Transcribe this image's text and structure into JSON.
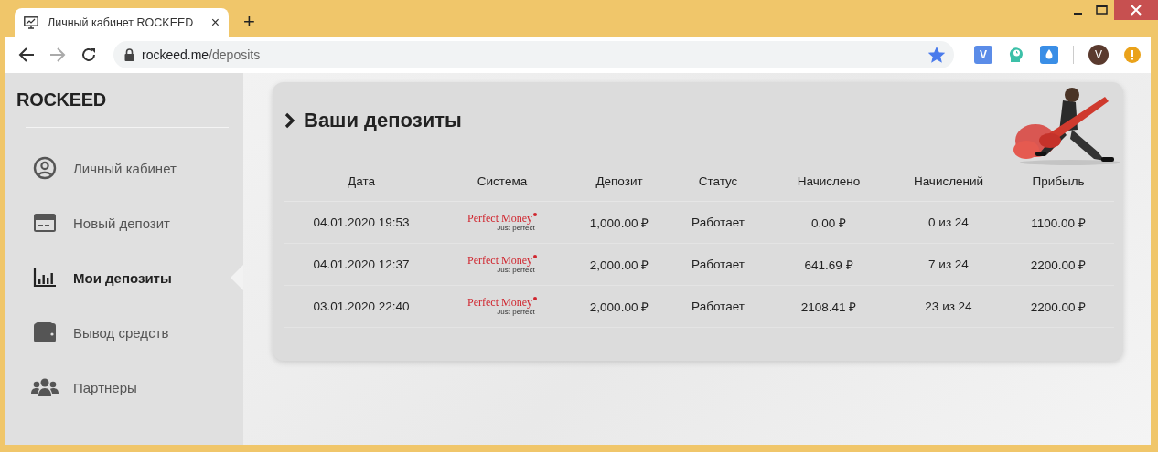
{
  "browser": {
    "tab": {
      "title": "Личный кабинет ROCKEED",
      "close": "×"
    },
    "new_tab": "+",
    "forward_disabled": true,
    "url_host": "rockeed.me",
    "url_path": "/deposits",
    "bookmarked": true,
    "extension_initial": "V",
    "profile_initial": "V"
  },
  "sidebar": {
    "brand": "ROCKEED",
    "items": [
      {
        "label": "Личный кабинет",
        "selected": false
      },
      {
        "label": "Новый депозит",
        "selected": false
      },
      {
        "label": "Мои депозиты",
        "selected": true
      },
      {
        "label": "Вывод средств",
        "selected": false
      },
      {
        "label": "Партнеры",
        "selected": false
      }
    ]
  },
  "deposits": {
    "title": "Ваши депозиты",
    "columns": [
      "Дата",
      "Система",
      "Депозит",
      "Статус",
      "Начислено",
      "Начислений",
      "Прибыль"
    ],
    "rows": [
      {
        "date": "04.01.2020 19:53",
        "system": "Perfect Money",
        "system_tagline": "Just perfect",
        "deposit": "1,000.00 ₽",
        "status": "Работает",
        "accrued": "0.00 ₽",
        "accruals": "0 из 24",
        "profit": "1100.00 ₽"
      },
      {
        "date": "04.01.2020 12:37",
        "system": "Perfect Money",
        "system_tagline": "Just perfect",
        "deposit": "2,000.00 ₽",
        "status": "Работает",
        "accrued": "641.69 ₽",
        "accruals": "7 из 24",
        "profit": "2200.00 ₽"
      },
      {
        "date": "03.01.2020 22:40",
        "system": "Perfect Money",
        "system_tagline": "Just perfect",
        "deposit": "2,000.00 ₽",
        "status": "Работает",
        "accrued": "2108.41 ₽",
        "accruals": "23 из 24",
        "profit": "2200.00 ₽"
      }
    ]
  }
}
